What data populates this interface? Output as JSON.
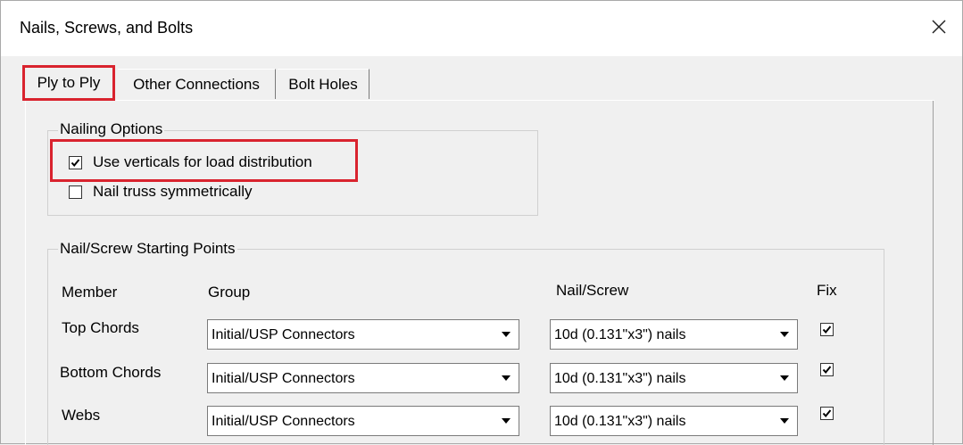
{
  "window": {
    "title": "Nails, Screws, and Bolts"
  },
  "tabs": [
    {
      "label": "Ply to Ply"
    },
    {
      "label": "Other Connections"
    },
    {
      "label": "Bolt Holes"
    }
  ],
  "nailing_options": {
    "legend": "Nailing Options",
    "use_verticals": {
      "label": "Use verticals for load distribution",
      "checked": true
    },
    "nail_symmetric": {
      "label": "Nail truss symmetrically",
      "checked": false
    }
  },
  "starting_points": {
    "legend": "Nail/Screw Starting Points",
    "headers": {
      "member": "Member",
      "group": "Group",
      "nail": "Nail/Screw",
      "fix": "Fix"
    },
    "rows": [
      {
        "member": "Top Chords",
        "group": "Initial/USP Connectors",
        "nail": "10d (0.131\"x3\") nails",
        "fix": true
      },
      {
        "member": "Bottom Chords",
        "group": "Initial/USP Connectors",
        "nail": "10d (0.131\"x3\") nails",
        "fix": true
      },
      {
        "member": "Webs",
        "group": "Initial/USP Connectors",
        "nail": "10d (0.131\"x3\") nails",
        "fix": true
      }
    ]
  },
  "colors": {
    "highlight": "#d9232e",
    "background": "#f0f0f0"
  }
}
